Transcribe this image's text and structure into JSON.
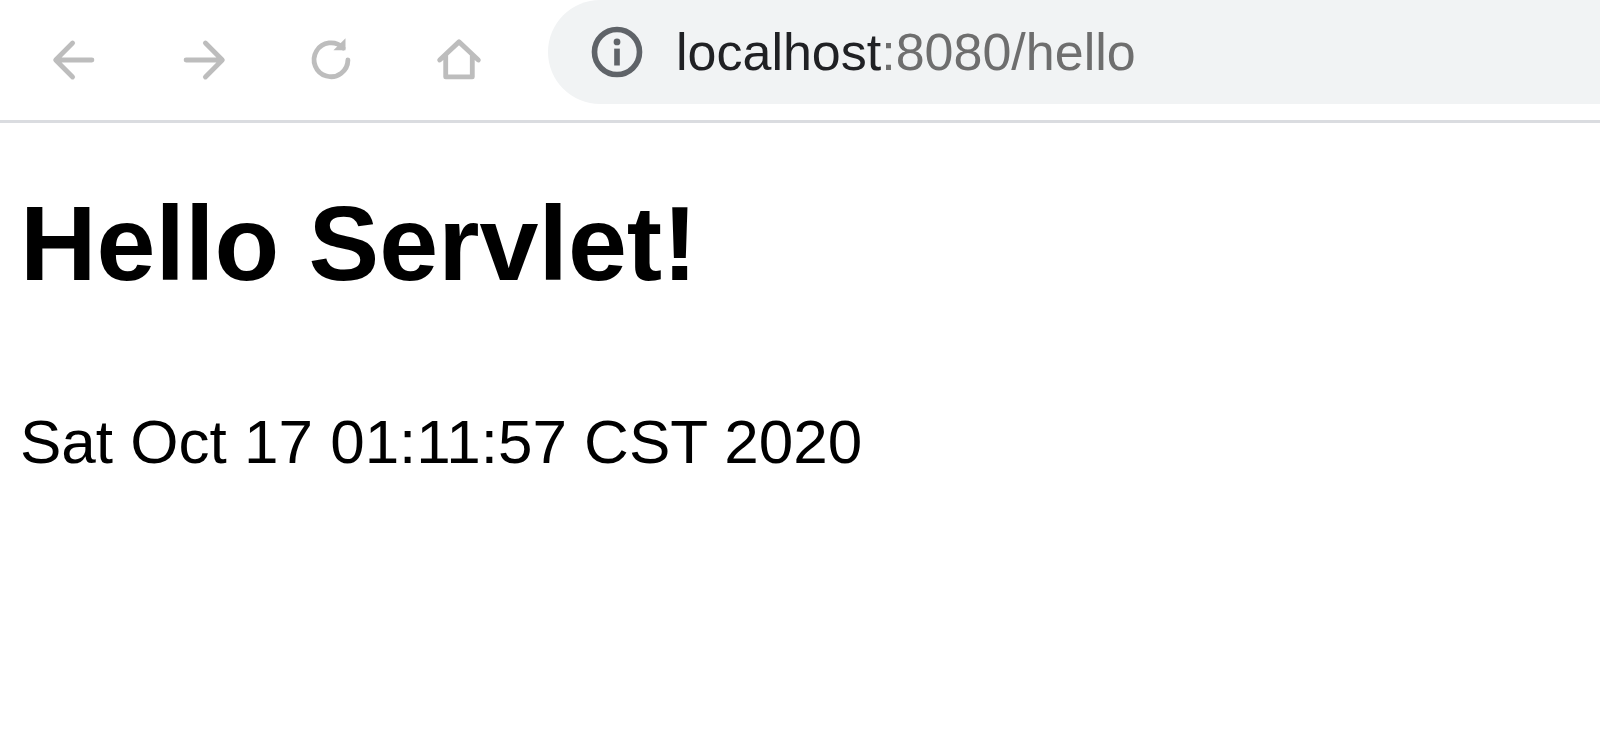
{
  "toolbar": {
    "buttons": [
      {
        "kind": "back"
      },
      {
        "kind": "forward"
      },
      {
        "kind": "reload"
      },
      {
        "kind": "home"
      }
    ],
    "address_bar": {
      "host": "localhost",
      "path": ":8080/hello"
    }
  },
  "page": {
    "heading": "Hello Servlet!",
    "date": "Sat Oct 17 01:11:57 CST 2020"
  }
}
